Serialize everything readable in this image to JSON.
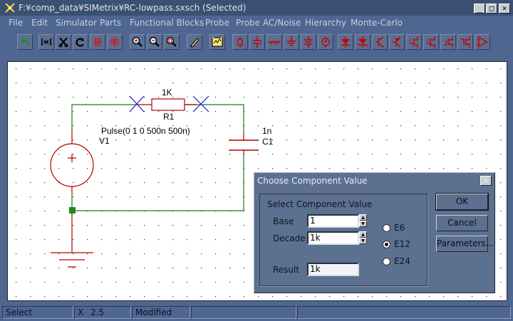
{
  "window": {
    "title": "F:¥comp_data¥SIMetrix¥RC-lowpass.sxsch (Selected)",
    "buttons": {
      "minimize": "_",
      "maximize": "□",
      "close": "×"
    }
  },
  "menu": [
    "File",
    "Edit",
    "Simulator",
    "Parts",
    "Functional Blocks",
    "Probe",
    "Probe AC/Noise",
    "Hierarchy",
    "Monte-Carlo"
  ],
  "toolbar": [
    {
      "icon": "undo-arrow-icon"
    },
    {
      "icon": "wire-mode-icon"
    },
    {
      "icon": "scissors-icon"
    },
    {
      "icon": "rotate-icon"
    },
    {
      "icon": "mirror-icon"
    },
    {
      "icon": "flip-icon"
    },
    {
      "icon": "zoom-in-icon"
    },
    {
      "icon": "zoom-out-icon"
    },
    {
      "icon": "zoom-fit-icon"
    },
    {
      "icon": "pencil-icon"
    },
    {
      "icon": "run-icon"
    },
    {
      "icon": "resistor-icon"
    },
    {
      "icon": "capacitor-icon"
    },
    {
      "icon": "inductor-icon"
    },
    {
      "icon": "ground-icon"
    },
    {
      "icon": "battery-icon"
    },
    {
      "icon": "source-icon"
    },
    {
      "icon": "diode-icon"
    },
    {
      "icon": "zener-icon"
    },
    {
      "icon": "npn-icon"
    },
    {
      "icon": "pnp-icon"
    },
    {
      "icon": "njfet-icon"
    },
    {
      "icon": "pjfet-icon"
    },
    {
      "icon": "nmos-icon"
    },
    {
      "icon": "pmos-icon"
    },
    {
      "icon": "opamp-icon"
    }
  ],
  "schematic": {
    "resistor": {
      "value": "1K",
      "ref": "R1"
    },
    "source": {
      "value": "Pulse(0 1   0 500n 500n)",
      "ref": "V1"
    },
    "capacitor": {
      "value": "1n",
      "ref": "C1"
    }
  },
  "dialog": {
    "title": "Choose Component Value",
    "close": "×",
    "group_label": "Select Component Value",
    "base_label": "Base",
    "base_value": "1",
    "decade_label": "Decade",
    "decade_value": "1k",
    "result_label": "Result",
    "result_value": "1k",
    "series": [
      {
        "label": "E6",
        "selected": false
      },
      {
        "label": "E12",
        "selected": true
      },
      {
        "label": "E24",
        "selected": false
      }
    ],
    "ok": "OK",
    "cancel": "Cancel",
    "parameters": "Parameters..."
  },
  "statusbar": {
    "mode": "Select",
    "x_label": "X",
    "x_value": "2.5",
    "state": "Modified"
  }
}
